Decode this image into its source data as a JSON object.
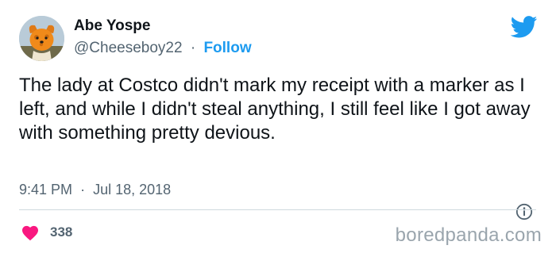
{
  "tweet": {
    "author": {
      "name": "Abe Yospe",
      "handle": "@Cheeseboy22",
      "separator": "·",
      "follow_label": "Follow",
      "avatar_icon": "cheese-dog-avatar"
    },
    "platform_icon": "twitter-bird-icon",
    "text": "The lady at Costco didn't mark my receipt with a marker as I left, and while I didn't steal anything, I still feel like I got away with something pretty devious.",
    "time": "9:41 PM",
    "date": "Jul 18, 2018",
    "likes": "338"
  },
  "colors": {
    "accent": "#1d9bf0",
    "heart": "#f91880",
    "muted": "#536471"
  },
  "watermark": "boredpanda.com"
}
